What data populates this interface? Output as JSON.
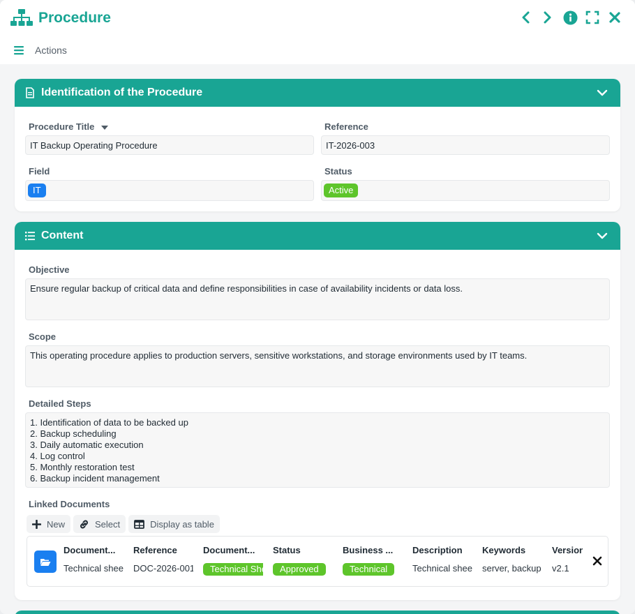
{
  "window": {
    "title": "Procedure",
    "actions_label": "Actions"
  },
  "colors": {
    "accent": "#19a594",
    "blue_badge": "#1a7ff0",
    "green_badge": "#5ec52b"
  },
  "identification": {
    "header": "Identification of the Procedure",
    "procedure_title_label": "Procedure Title",
    "procedure_title_value": "IT Backup Operating Procedure",
    "reference_label": "Reference",
    "reference_value": "IT-2026-003",
    "field_label": "Field",
    "field_value": "IT",
    "status_label": "Status",
    "status_value": "Active"
  },
  "content": {
    "header": "Content",
    "objective_label": "Objective",
    "objective_value": "Ensure regular backup of critical data and define responsibilities in case of availability incidents or data loss.",
    "scope_label": "Scope",
    "scope_value": "This operating procedure applies to production servers, sensitive workstations, and storage environments used by IT teams.",
    "steps_label": "Detailed Steps",
    "steps_value": "1. Identification of data to be backed up\n2. Backup scheduling\n3. Daily automatic execution\n4. Log control\n5. Monthly restoration test\n6. Backup incident management",
    "linked_docs_label": "Linked Documents",
    "buttons": {
      "new": "New",
      "select": "Select",
      "display_table": "Display as table"
    },
    "doc_columns": {
      "document_name": "Document...",
      "reference": "Reference",
      "document_type": "Document...",
      "status": "Status",
      "business": "Business ...",
      "description": "Description",
      "keywords": "Keywords",
      "version": "Version"
    },
    "doc_row": {
      "document_name": "Technical sheet",
      "reference": "DOC-2026-001",
      "document_type": "Technical Sheet",
      "status": "Approved",
      "business": "Technical",
      "description": "Technical sheet",
      "keywords": "server, backup",
      "version": "v2.1"
    }
  }
}
